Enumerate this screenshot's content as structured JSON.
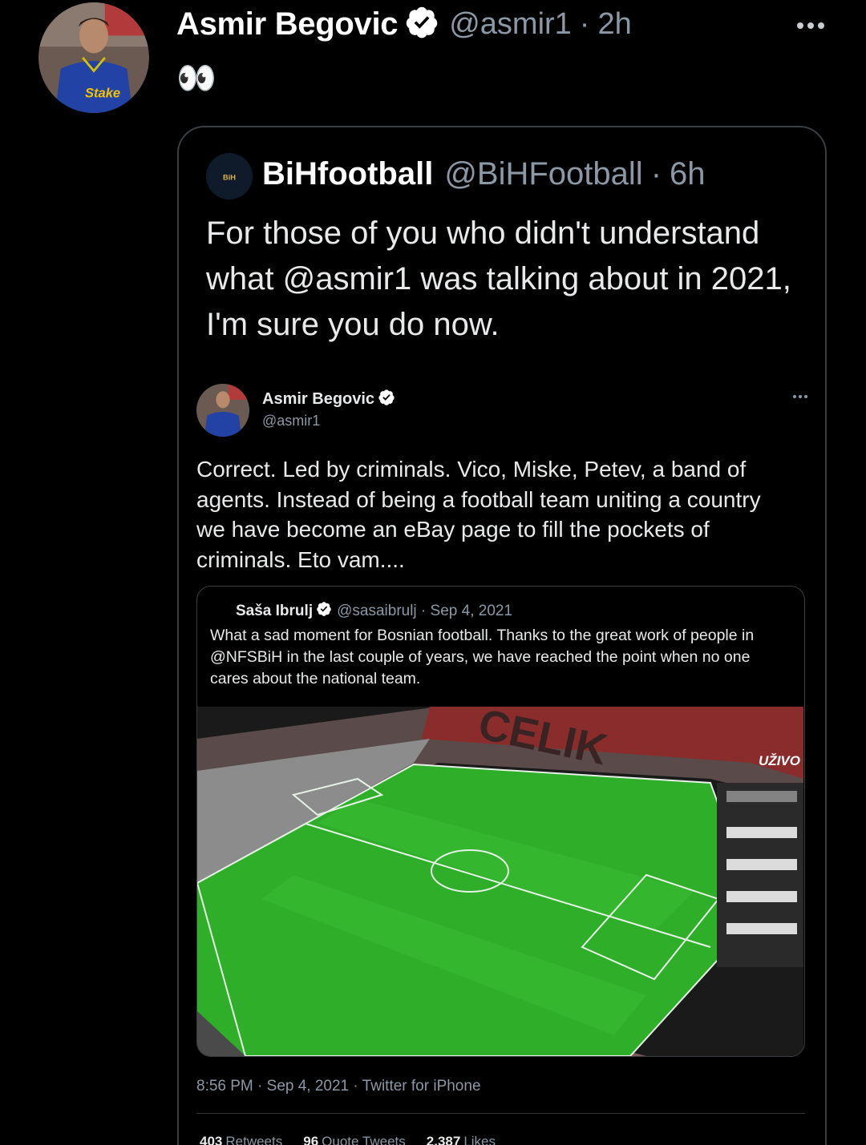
{
  "tweet": {
    "author_name": "Asmir Begovic",
    "author_handle": "@asmir1",
    "time": "2h",
    "separator": "·",
    "text": "👀"
  },
  "quoted": {
    "author_name": "BiHfootball",
    "author_handle": "@BiHFootball",
    "time": "6h",
    "separator": "·",
    "text": "For those of you who didn't understand what @asmir1  was talking about in 2021, I'm sure you do now."
  },
  "embedded": {
    "author_name": "Asmir Begovic",
    "author_handle": "@asmir1",
    "text": "Correct. Led by criminals. Vico, Miske, Petev, a band of agents. Instead of being a football team uniting a country we have become an eBay page to fill the pockets of criminals. Eto vam....",
    "meta": "8:56 PM · Sep 4, 2021 · Twitter for iPhone",
    "stats": {
      "retweets_count": "403",
      "retweets_label": "Retweets",
      "quote_count": "96",
      "quote_label": "Quote Tweets",
      "likes_count": "2,387",
      "likes_label": "Likes"
    },
    "inner_quote": {
      "author_name": "Saša Ibrulj",
      "author_handle": "@sasaibrulj · Sep 4, 2021",
      "text": "What a sad moment for Bosnian football. Thanks to the great work of people in @NFSBiH in the last couple of years, we have reached the point when no one cares about the national team.",
      "image_overlay": "UŽIVO",
      "stand_letters": "CELIK"
    }
  },
  "colors": {
    "background": "#000000",
    "text": "#e7e9ea",
    "secondary": "#8b98a5",
    "verified": "#ffffff",
    "pitch": "#2fae2a"
  }
}
